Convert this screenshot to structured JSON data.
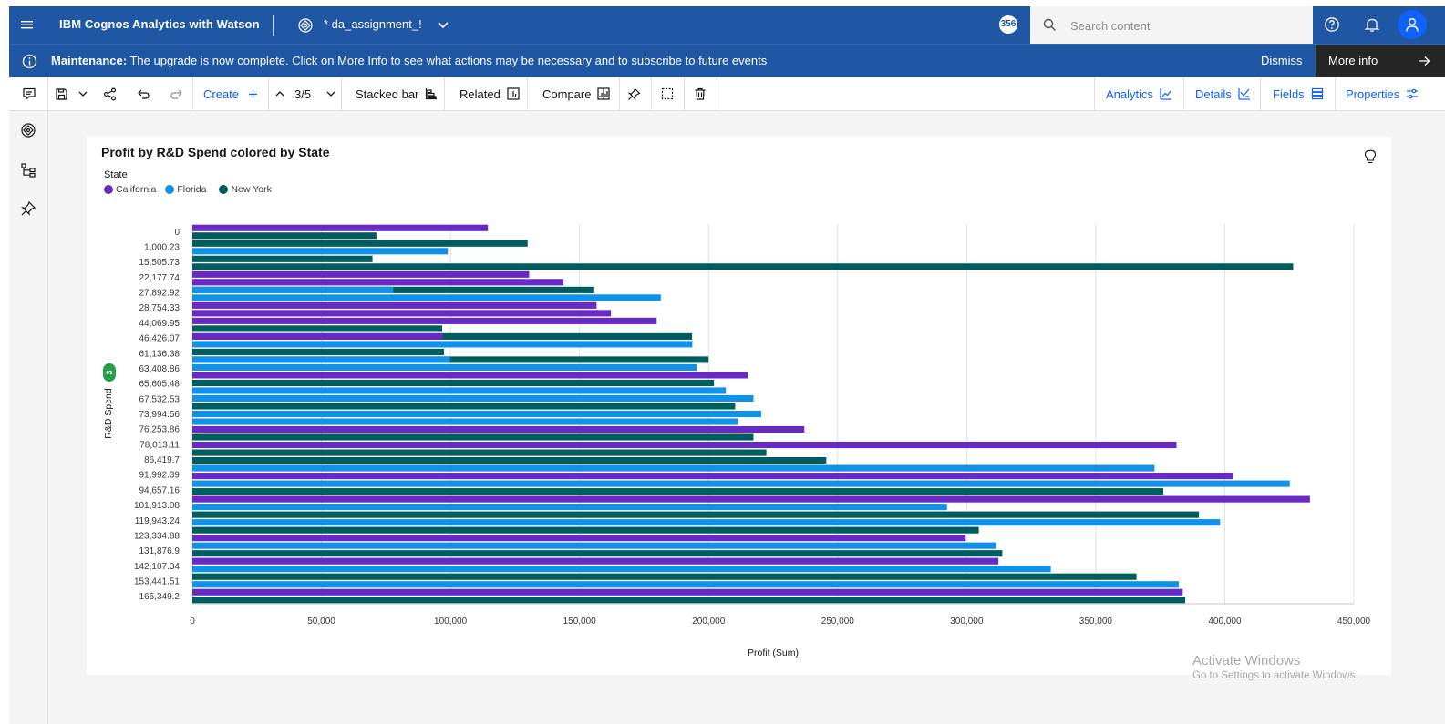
{
  "topbar": {
    "brand": "IBM Cognos Analytics with Watson",
    "document_title": "* da_assignment_!",
    "notification_count": "356",
    "search_placeholder": "Search content"
  },
  "banner": {
    "label": "Maintenance:",
    "message": "The upgrade is now complete. Click on More Info to see what actions may be necessary and to subscribe to future events",
    "dismiss": "Dismiss",
    "more_info": "More info"
  },
  "toolbar": {
    "create": "Create",
    "page_indicator": "3/5",
    "visualization_type": "Stacked bar",
    "related": "Related",
    "compare": "Compare",
    "analytics": "Analytics",
    "details": "Details",
    "fields": "Fields",
    "properties": "Properties"
  },
  "chart_data": {
    "type": "bar",
    "orientation": "horizontal",
    "title": "Profit by R&D Spend colored by State",
    "legend_title": "State",
    "legend_placement": "top-left",
    "xlabel": "Profit (Sum)",
    "ylabel": "R&D Spend",
    "ylabel_badge": "3",
    "xlim": [
      0,
      450000
    ],
    "xticks": [
      "0",
      "50,000",
      "100,000",
      "150,000",
      "200,000",
      "250,000",
      "300,000",
      "350,000",
      "400,000",
      "450,000"
    ],
    "grid": "vertical",
    "y_tick_labels": [
      "0",
      "1,000.23",
      "15,505.73",
      "22,177.74",
      "27,892.92",
      "28,754.33",
      "44,069.95",
      "46,426.07",
      "61,136.38",
      "63,408.86",
      "65,605.48",
      "67,532.53",
      "73,994.56",
      "76,253.86",
      "78,013.11",
      "86,419.7",
      "91,992.39",
      "94,657.16",
      "101,913.08",
      "119,943.24",
      "123,334.88",
      "131,876.9",
      "142,107.34",
      "153,441.51",
      "165,349.2"
    ],
    "series": [
      {
        "name": "California",
        "color": "#6929c4"
      },
      {
        "name": "Florida",
        "color": "#1192e8"
      },
      {
        "name": "New York",
        "color": "#005d5d"
      }
    ],
    "bars": [
      {
        "s": 0,
        "v": 114500
      },
      {
        "s": 2,
        "v": 71300
      },
      {
        "s": 2,
        "v": 129900
      },
      {
        "s": 1,
        "v": 99000
      },
      {
        "s": 2,
        "v": 69800
      },
      {
        "s": 2,
        "v": 426500
      },
      {
        "s": 0,
        "v": 130500
      },
      {
        "s": 0,
        "v": 143800
      },
      {
        "s": 2,
        "v": 155700,
        "overlay": {
          "s": 1,
          "v": 77800
        }
      },
      {
        "s": 1,
        "v": 181500
      },
      {
        "s": 0,
        "v": 156600
      },
      {
        "s": 0,
        "v": 162200
      },
      {
        "s": 0,
        "v": 179900
      },
      {
        "s": 2,
        "v": 96800
      },
      {
        "s": 2,
        "v": 193600,
        "overlay": {
          "s": 0,
          "v": 97000
        }
      },
      {
        "s": 1,
        "v": 193700
      },
      {
        "s": 2,
        "v": 97500
      },
      {
        "s": 2,
        "v": 200000,
        "overlay": {
          "s": 1,
          "v": 99900
        }
      },
      {
        "s": 1,
        "v": 195400
      },
      {
        "s": 0,
        "v": 215100
      },
      {
        "s": 2,
        "v": 202100
      },
      {
        "s": 1,
        "v": 206700
      },
      {
        "s": 1,
        "v": 217400
      },
      {
        "s": 2,
        "v": 210300
      },
      {
        "s": 1,
        "v": 220400
      },
      {
        "s": 1,
        "v": 211400
      },
      {
        "s": 0,
        "v": 237100
      },
      {
        "s": 2,
        "v": 217400
      },
      {
        "s": 0,
        "v": 381300
      },
      {
        "s": 2,
        "v": 222400
      },
      {
        "s": 2,
        "v": 245600
      },
      {
        "s": 1,
        "v": 372800
      },
      {
        "s": 0,
        "v": 403100
      },
      {
        "s": 1,
        "v": 425200
      },
      {
        "s": 2,
        "v": 376200
      },
      {
        "s": 0,
        "v": 433000
      },
      {
        "s": 1,
        "v": 292400
      },
      {
        "s": 2,
        "v": 390000
      },
      {
        "s": 1,
        "v": 398200
      },
      {
        "s": 2,
        "v": 304700
      },
      {
        "s": 0,
        "v": 299600
      },
      {
        "s": 1,
        "v": 311400
      },
      {
        "s": 2,
        "v": 313800
      },
      {
        "s": 0,
        "v": 312300
      },
      {
        "s": 1,
        "v": 332600
      },
      {
        "s": 2,
        "v": 365800
      },
      {
        "s": 1,
        "v": 382200
      },
      {
        "s": 0,
        "v": 383700
      },
      {
        "s": 2,
        "v": 384700
      }
    ]
  },
  "watermark": {
    "line1": "Activate Windows",
    "line2": "Go to Settings to activate Windows."
  }
}
